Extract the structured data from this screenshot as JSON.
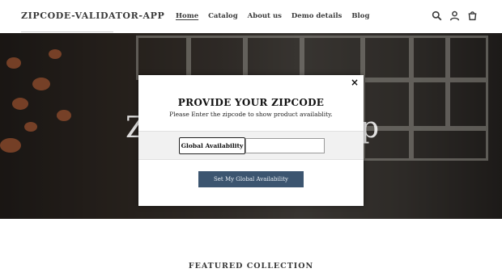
{
  "header": {
    "logo": "ZIPCODE-VALIDATOR-APP",
    "nav": [
      {
        "label": "Home",
        "active": true
      },
      {
        "label": "Catalog",
        "active": false
      },
      {
        "label": "About us",
        "active": false
      },
      {
        "label": "Demo details",
        "active": false
      },
      {
        "label": "Blog",
        "active": false
      }
    ],
    "icons": [
      "search-icon",
      "account-icon",
      "cart-icon"
    ]
  },
  "hero": {
    "title_left": "Z",
    "title_right": "p"
  },
  "modal": {
    "close": "×",
    "title": "PROVIDE YOUR ZIPCODE",
    "subtitle": "Please Enter the zipcode to show product availablity.",
    "label": "Global Availability",
    "input_value": "",
    "button": "Set My Global Availability"
  },
  "featured": {
    "heading": "FEATURED COLLECTION"
  },
  "colors": {
    "button": "#3c5570",
    "text": "#3a3a3a"
  }
}
